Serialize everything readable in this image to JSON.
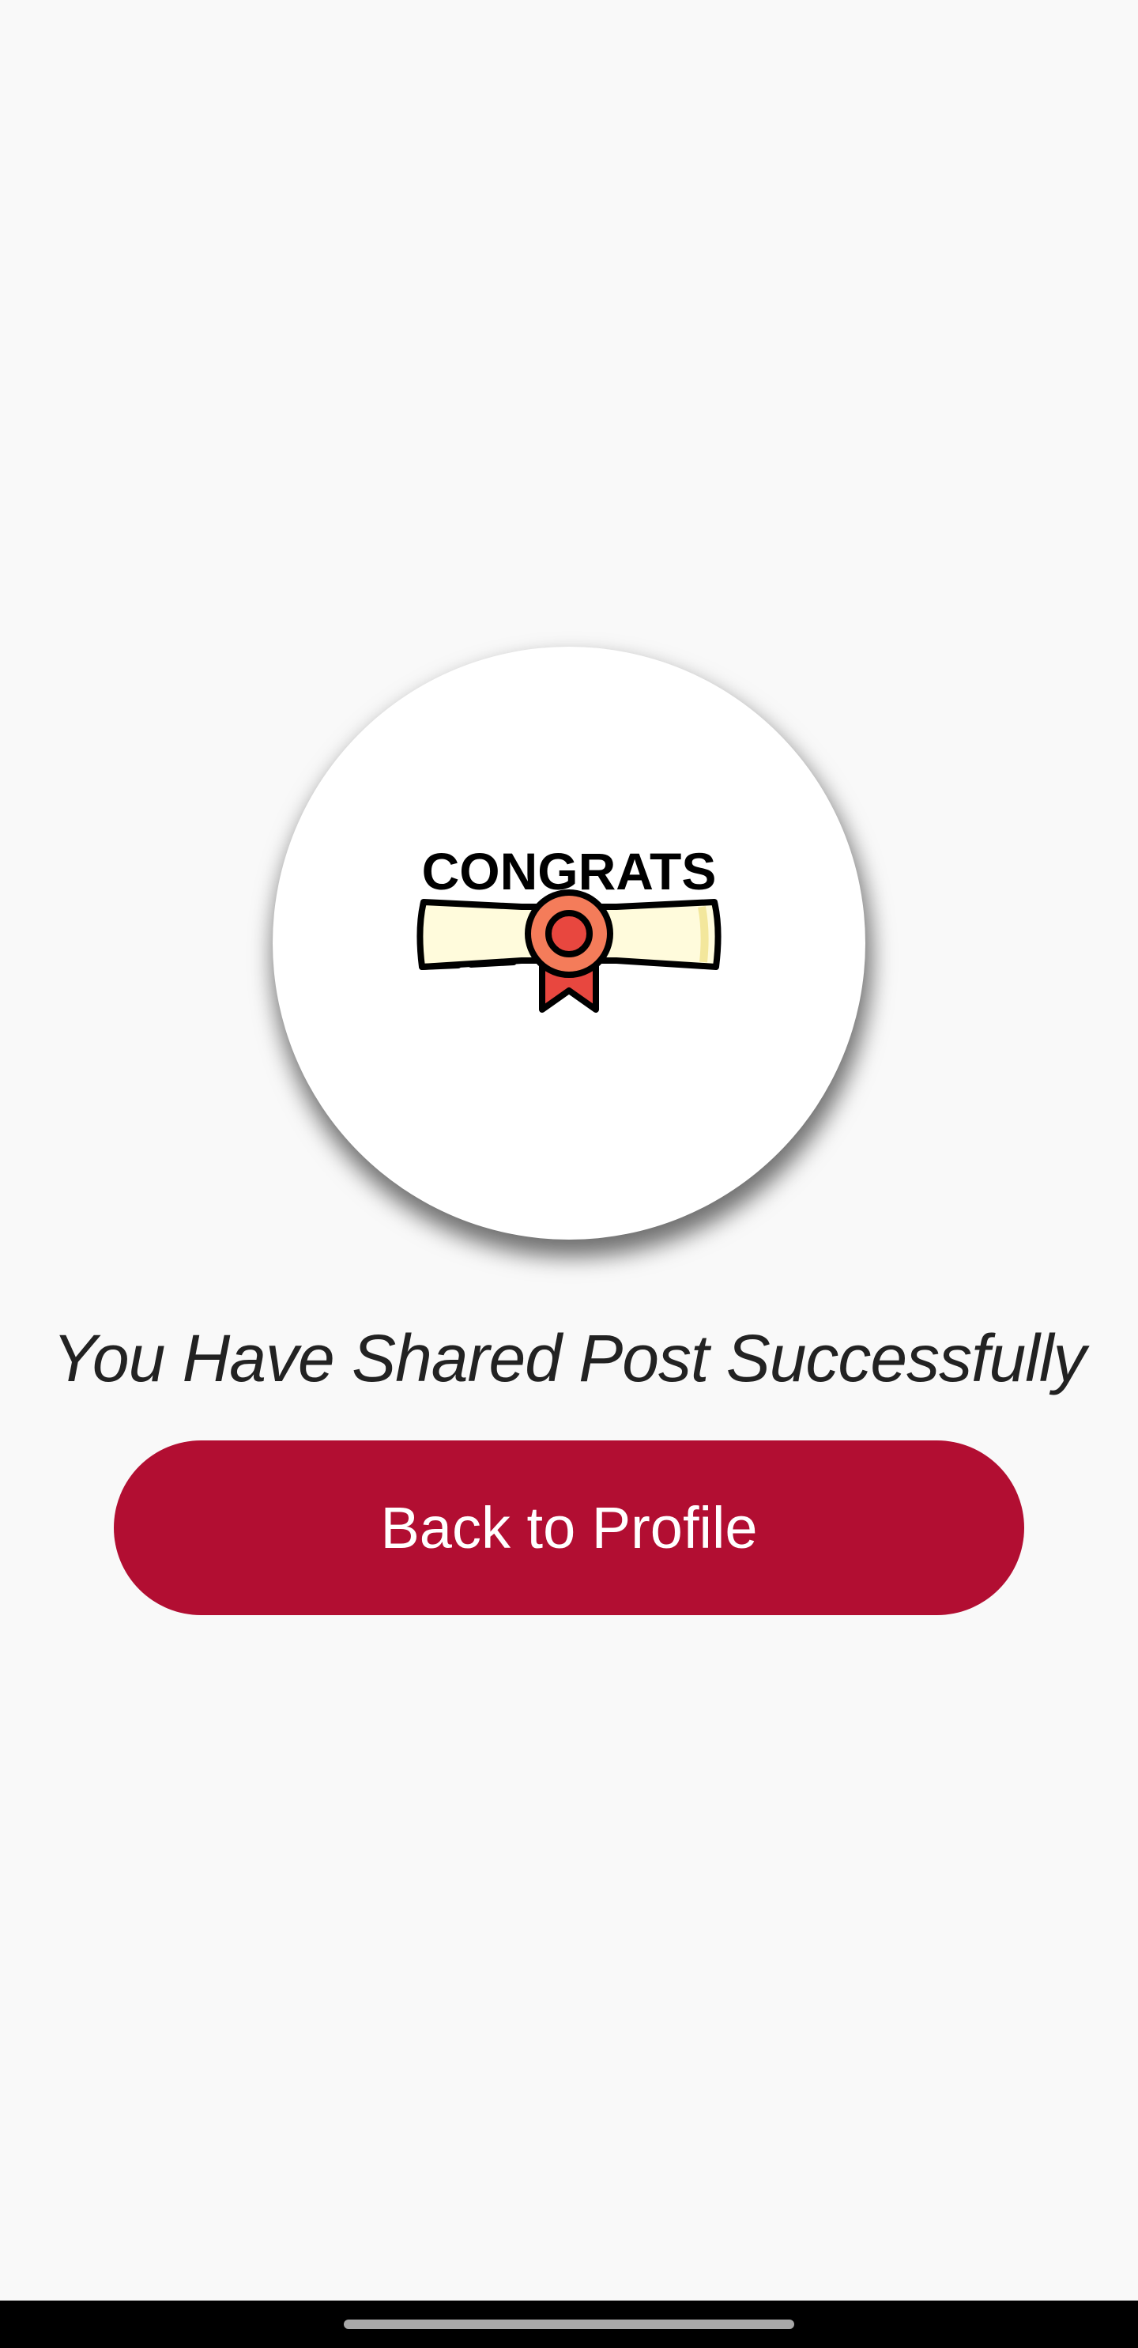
{
  "badge": {
    "icon": "congrats-diploma-icon",
    "text": "CONGRATS"
  },
  "message": "You Have Shared Post Successfully",
  "back_button": {
    "label": "Back to Profile"
  },
  "colors": {
    "background": "#f9f9f9",
    "button": "#b20e32",
    "button_text": "#ffffff",
    "message_text": "#222222",
    "ribbon_seal": "#f47c5a",
    "ribbon_tail": "#e8473f",
    "scroll_paper": "#fffbdc"
  },
  "system_nav": {
    "home_indicator": "home-indicator-bar"
  }
}
